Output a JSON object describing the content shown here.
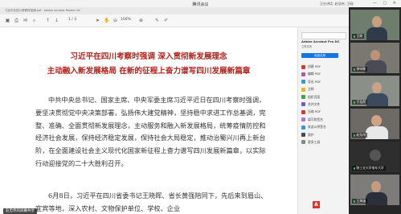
{
  "meeting": {
    "title": "腾讯会议",
    "sharing_status": "正在讲话: 赵浩伟; 王刚;",
    "window_controls": "— ▢ ✕"
  },
  "acrobat": {
    "window_title": "习近平在四川考察时强调.pdf - Adobe Acrobat Reader DC",
    "page_number": "1 / 3",
    "zoom": "100%",
    "panel": {
      "promo_title": "Adobe Acrobat Pro DC",
      "promo_subtitle": "立即试用",
      "promo_button": "免费试用",
      "tools": [
        "创建 PDF",
        "编辑 PDF",
        "导出 PDF",
        "注释",
        "组织页面",
        "合并文件",
        "压缩 PDF",
        "填写和签名",
        "发送以供签名",
        "保护",
        "更多工具"
      ],
      "tool_colors": [
        "#e4312e",
        "#c64bb5",
        "#2d9cdb",
        "#f2b705",
        "#39a849",
        "#6a5acd",
        "#e4312e",
        "#b56fd6",
        "#2d9cdb",
        "#4a4a4a",
        "#888888"
      ]
    }
  },
  "document": {
    "title_line1": "习近平在四川考察时强调  深入贯彻新发展理念",
    "title_line2": "主动融入新发展格局  在新的征程上奋力谱写四川发展新篇章",
    "paragraph1": "中共中央总书记、国家主席、中央军委主席习近平近日在四川考察时强调，要坚决贯彻党中央决策部署，弘扬伟大建党精神，坚持稳中求进工作总基调，完整、准确、全面贯彻新发展理念，主动服务和融入新发展格局，统筹疫情防控和经济社会发展，保持经济稳定发展，保持社会大局稳定，推动治蜀兴川再上新台阶，在全面建设社会主义现代化国家新征程上奋力谱写四川发展新篇章，以实际行动迎接党的二十大胜利召开。",
    "paragraph2": "6月8日，习近平在四川省委书记王晓晖、省长黄强陪同下，先后来到眉山、宜宾等地，深入农村、文物保护单位、学校、企业"
  },
  "share_badge": "赵忠伟的屏幕共享",
  "participants": [
    {
      "name": "王刚"
    },
    {
      "name": "李申晓"
    },
    {
      "name": "于浩然"
    },
    {
      "name": "赵浩伟"
    },
    {
      "name": "陕工业大学电车大学"
    },
    {
      "name": "王海涵"
    }
  ]
}
